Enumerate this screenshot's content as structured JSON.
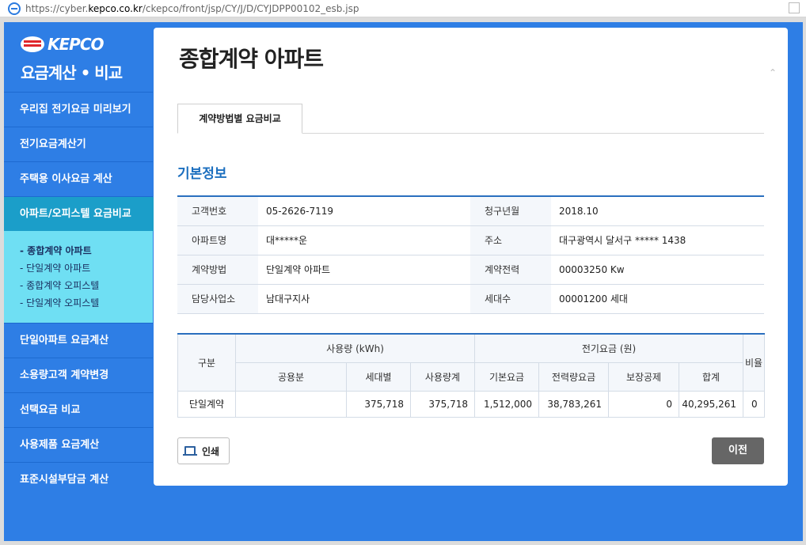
{
  "browser": {
    "url_prefix": "https://cyber.",
    "url_domain": "kepco.co.kr",
    "url_path": "/ckepco/front/jsp/CY/J/D/CYJDPP00102_esb.jsp"
  },
  "sidebar": {
    "logo_text": "KEPCO",
    "logo_subtitle": "요금계산 • 비교",
    "items": [
      {
        "label": "우리집 전기요금 미리보기"
      },
      {
        "label": "전기요금계산기"
      },
      {
        "label": "주택용 이사요금 계산"
      },
      {
        "label": "아파트/오피스텔 요금비교"
      },
      {
        "label": "단일아파트 요금계산"
      },
      {
        "label": "소용량고객 계약변경"
      },
      {
        "label": "선택요금 비교"
      },
      {
        "label": "사용제품 요금계산"
      },
      {
        "label": "표준시설부담금 계산"
      }
    ],
    "subitems": [
      {
        "label": "- 종합계약 아파트"
      },
      {
        "label": "- 단일계약 아파트"
      },
      {
        "label": "- 종합계약 오피스텔"
      },
      {
        "label": "- 단일계약 오피스텔"
      }
    ]
  },
  "main": {
    "title": "종합계약 아파트",
    "tab_label": "계약방법별 요금비교",
    "section_title": "기본정보",
    "info": {
      "customer_no_label": "고객번호",
      "customer_no": "05-2626-7119",
      "bill_month_label": "청구년월",
      "bill_month": "2018.10",
      "apt_name_label": "아파트명",
      "apt_name": "대*****운",
      "address_label": "주소",
      "address": "대구광역시 달서구 ***** 1438",
      "contract_method_label": "계약방법",
      "contract_method": "단일계약 아파트",
      "contract_power_label": "계약전력",
      "contract_power": "00003250 Kw",
      "office_label": "담당사업소",
      "office": "남대구지사",
      "households_label": "세대수",
      "households": "00001200 세대"
    },
    "grid": {
      "col_category": "구분",
      "group_usage": "사용량 (kWh)",
      "group_charge": "전기요금 (원)",
      "col_ratio": "비율",
      "col_common": "공용분",
      "col_household": "세대별",
      "col_usage_total": "사용량계",
      "col_basic": "기본요금",
      "col_energy": "전력량요금",
      "col_deduction": "보장공제",
      "col_total": "합계",
      "row": {
        "label": "단일계약",
        "common": "",
        "household": "375,718",
        "usage_total": "375,718",
        "basic": "1,512,000",
        "energy": "38,783,261",
        "deduction": "0",
        "total": "40,295,261",
        "ratio": "0"
      }
    },
    "print_label": "인쇄",
    "prev_label": "이전"
  }
}
